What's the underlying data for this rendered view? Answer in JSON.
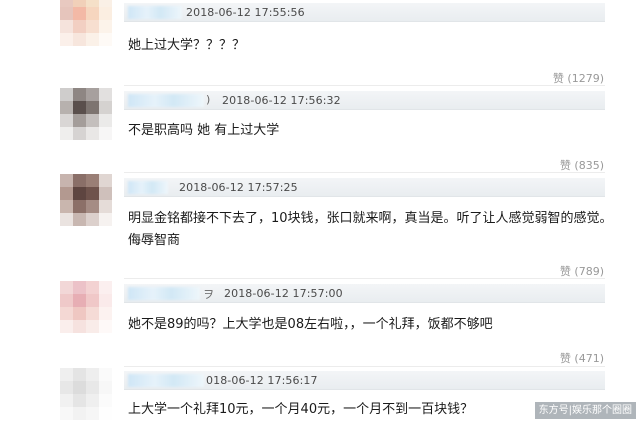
{
  "comments": [
    {
      "time": "2018-06-12 17:55:56",
      "paren": "",
      "text": "她上过大学？？？？",
      "likes": "赞 (1279)",
      "avatar": [
        "#e8c9c0",
        "#f1d0b9",
        "#f5e0c8",
        "#faf0e6",
        "#e6c5bc",
        "#f3b9a6",
        "#f6d6bf",
        "#fbeee1",
        "#f5e3dc",
        "#f2cfc2",
        "#f7dfd0",
        "#fcf3ea",
        "#fbf0ea",
        "#f7e6dd",
        "#fbf1e8",
        "#fefaf6"
      ]
    },
    {
      "time": "2018-06-12 17:56:32",
      "paren": ")",
      "text": "不是职高吗 她 有上过大学",
      "likes": "赞 (835)",
      "avatar": [
        "#cfcdcc",
        "#8e8683",
        "#a7a09e",
        "#e2e0df",
        "#b7b1ae",
        "#5a4f4c",
        "#7d7470",
        "#d5d2d0",
        "#d9d6d5",
        "#a49d9a",
        "#c4bfbd",
        "#ebeae9",
        "#efeeed",
        "#d6d3d2",
        "#e9e7e6",
        "#f7f6f6"
      ]
    },
    {
      "time": "2018-06-12 17:57:25",
      "paren": "",
      "text": "明显金铭都接不下去了，10块钱，张口就来啊，真当是。听了让人感觉弱智的感觉。侮辱智商",
      "likes": "赞 (789)",
      "avatar": [
        "#c7b4ae",
        "#8a6f68",
        "#9a7f76",
        "#e0d6d2",
        "#b39990",
        "#5e4540",
        "#6f534c",
        "#cfc0bb",
        "#c9b6ae",
        "#8c7068",
        "#a58c84",
        "#e5dcd8",
        "#eae3e0",
        "#c8b7b1",
        "#dcd0cc",
        "#f6f2f0"
      ]
    },
    {
      "time": "2018-06-12 17:57:00",
      "paren": "ヲ",
      "text": "她不是89的吗？上大学也是08左右啦，，一个礼拜，饭都不够吧",
      "likes": "赞 (471)",
      "avatar": [
        "#f2d7d7",
        "#ecc2c8",
        "#f3d2d2",
        "#fbefef",
        "#efc9c9",
        "#e7aeb4",
        "#f0c8c8",
        "#faeaea",
        "#f4d8d4",
        "#efc7c2",
        "#f5dbd6",
        "#fcf2f0",
        "#faeeec",
        "#f6e2df",
        "#f9ece9",
        "#fef9f8"
      ]
    },
    {
      "time": "018-06-12 17:56:17",
      "paren": "",
      "text": "上大学一个礼拜10元，一个月40元，一个月不到一百块钱？",
      "likes": "",
      "avatar": [
        "#efefef",
        "#e4e4e4",
        "#eeeeee",
        "#fafafa",
        "#e7e7e7",
        "#dcdcdc",
        "#e8e8e8",
        "#f7f7f7",
        "#f1f1f1",
        "#e5e5e5",
        "#efefef",
        "#fbfbfb",
        "#f8f8f8",
        "#f2f2f2",
        "#f6f6f6",
        "#fefefe"
      ]
    }
  ],
  "watermark": "东方号|娱乐那个圈圈"
}
